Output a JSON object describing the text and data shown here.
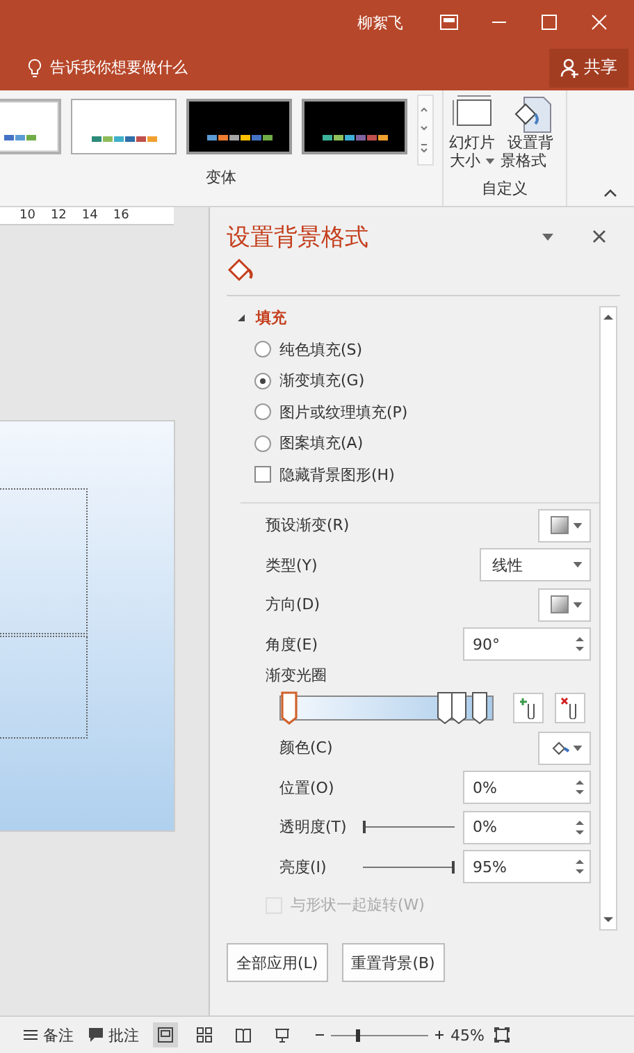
{
  "title_bar": {
    "user": "柳絮飞",
    "tell_me": "告诉我你想要做什么",
    "share": "共享"
  },
  "ribbon": {
    "variants": [
      {
        "kind": "light",
        "selected": true,
        "swatches": [
          {
            "color": "#4472c4"
          },
          {
            "color": "#5b9bd5"
          },
          {
            "color": "#70ad47"
          }
        ]
      },
      {
        "kind": "light",
        "selected": false,
        "swatches": [
          {
            "color": "#2e8b7a"
          },
          {
            "color": "#8fbc5a"
          },
          {
            "color": "#3fb0c9"
          },
          {
            "color": "#2f6ea8"
          },
          {
            "color": "#c0504d"
          },
          {
            "color": "#f0a030"
          }
        ]
      },
      {
        "kind": "dark",
        "selected": false,
        "swatches": [
          {
            "color": "#5b9bd5"
          },
          {
            "color": "#ed7d31"
          },
          {
            "color": "#a5a5a5"
          },
          {
            "color": "#ffc000"
          },
          {
            "color": "#4472c4"
          },
          {
            "color": "#70ad47"
          }
        ]
      },
      {
        "kind": "dark",
        "selected": false,
        "swatches": [
          {
            "color": "#3cb39a"
          },
          {
            "color": "#8fc25a"
          },
          {
            "color": "#3fb0d9"
          },
          {
            "color": "#8064a2"
          },
          {
            "color": "#c0504d"
          },
          {
            "color": "#f0a030"
          }
        ]
      }
    ],
    "variants_label": "变体",
    "buttons": [
      {
        "line1": "幻灯片",
        "line2": "大小",
        "dropdown": true
      },
      {
        "line1": "设置背",
        "line2": "景格式",
        "dropdown": false
      }
    ],
    "custom_label": "自定义"
  },
  "ruler": [
    "10",
    "12",
    "14",
    "16"
  ],
  "panel": {
    "title": "设置背景格式",
    "section": "填充",
    "expanded": true,
    "fill_options": [
      {
        "label": "纯色填充(S)",
        "selected": false
      },
      {
        "label": "渐变填充(G)",
        "selected": true
      },
      {
        "label": "图片或纹理填充(P)",
        "selected": false
      },
      {
        "label": "图案填充(A)",
        "selected": false
      }
    ],
    "hide_graphics": {
      "label": "隐藏背景图形(H)",
      "checked": false
    },
    "preset_label": "预设渐变(R)",
    "type_label": "类型(Y)",
    "type_value": "线性",
    "direction_label": "方向(D)",
    "angle_label": "角度(E)",
    "angle_value": "90°",
    "stops_label": "渐变光圈",
    "stops": [
      {
        "level": 0,
        "selected": true
      },
      {
        "level": 0.8,
        "selected": false
      },
      {
        "level": 0.87,
        "selected": false
      },
      {
        "level": 0.98,
        "selected": false
      }
    ],
    "color_label": "颜色(C)",
    "position_label": "位置(O)",
    "position_value": "0%",
    "transparency": {
      "label": "透明度(T)",
      "level": 0,
      "value": "0%"
    },
    "brightness": {
      "label": "亮度(I)",
      "level": 1,
      "value": "95%"
    },
    "rotate": {
      "label": "与形状一起旋转(W)",
      "checked": false,
      "disabled": true
    },
    "apply_all": "全部应用(L)",
    "reset": "重置背景(B)"
  },
  "status_bar": {
    "notes": "备注",
    "comments": "批注",
    "zoom": {
      "text": "45%",
      "level": 0.25
    }
  }
}
